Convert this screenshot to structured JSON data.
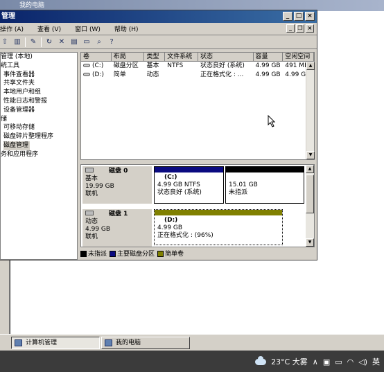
{
  "bg_window": {
    "title": "我的电脑"
  },
  "window": {
    "title": "管理",
    "controls": {
      "minimize": "_",
      "maximize": "□",
      "close": "×"
    },
    "mdi_controls": {
      "minimize": "_",
      "restore": "❐",
      "close": "×"
    }
  },
  "menu": [
    "操作 (A)",
    "查看 (V)",
    "窗口 (W)",
    "帮助 (H)"
  ],
  "tree": [
    {
      "label": "管理 (本地)",
      "indent": 0
    },
    {
      "label": "统工具",
      "indent": 0
    },
    {
      "label": "事件查看器",
      "indent": 1
    },
    {
      "label": "共享文件夹",
      "indent": 1
    },
    {
      "label": "本地用户和组",
      "indent": 1
    },
    {
      "label": "性能日志和警报",
      "indent": 1
    },
    {
      "label": "设备管理器",
      "indent": 1
    },
    {
      "label": "储",
      "indent": 0
    },
    {
      "label": "可移动存储",
      "indent": 1
    },
    {
      "label": "磁盘碎片整理程序",
      "indent": 1
    },
    {
      "label": "磁盘管理",
      "indent": 1,
      "selected": true
    },
    {
      "label": "务和应用程序",
      "indent": 0
    }
  ],
  "volume_list": {
    "columns": [
      "卷",
      "布局",
      "类型",
      "文件系统",
      "状态",
      "容量",
      "空闲空间"
    ],
    "rows": [
      [
        "(C:)",
        "磁盘分区",
        "基本",
        "NTFS",
        "状态良好 (系统)",
        "4.99 GB",
        "491 MB"
      ],
      [
        "(D:)",
        "简单",
        "动态",
        "",
        "正在格式化 : ...",
        "4.99 GB",
        "4.99 GB"
      ]
    ]
  },
  "disks": [
    {
      "name": "磁盘 0",
      "type": "基本",
      "size": "19.99 GB",
      "status": "联机",
      "partitions": [
        {
          "label": "(C:)",
          "detail": "4.99 GB NTFS",
          "status": "状态良好 (系统)",
          "color": "#0a0a80"
        },
        {
          "label": "",
          "detail": "15.01 GB",
          "status": "未指派",
          "color": "#000000"
        }
      ]
    },
    {
      "name": "磁盘 1",
      "type": "动态",
      "size": "4.99 GB",
      "status": "联机",
      "partitions": [
        {
          "label": "(D:)",
          "detail": "4.99 GB",
          "status": "正在格式化 : (96%)",
          "color": "#808000"
        }
      ]
    }
  ],
  "legend": [
    {
      "label": "未指派",
      "color": "#000000"
    },
    {
      "label": "主要磁盘分区",
      "color": "#0a0a80"
    },
    {
      "label": "简单卷",
      "color": "#808000"
    }
  ],
  "taskbar_old": [
    {
      "label": "计算机管理",
      "active": true
    },
    {
      "label": "我的电脑",
      "active": false
    }
  ],
  "taskbar_tray": {
    "weather": "23°C 大雾",
    "ime": "英"
  }
}
